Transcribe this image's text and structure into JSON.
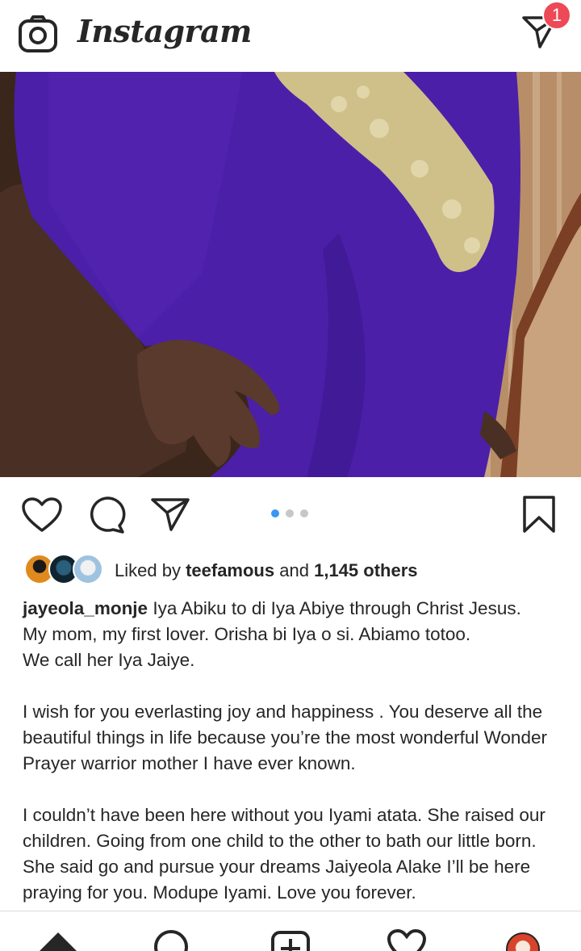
{
  "header": {
    "app_name": "Instagram",
    "camera_icon": "camera-icon",
    "direct_icon": "paper-plane-icon",
    "notification_count": "1"
  },
  "post": {
    "actions": {
      "like_icon": "heart-icon",
      "comment_icon": "comment-icon",
      "share_icon": "paper-plane-icon",
      "save_icon": "bookmark-icon"
    },
    "carousel": {
      "total": 3,
      "active_index": 0,
      "active_color": "#3897f0"
    },
    "likes": {
      "prefix": "Liked by",
      "user": "teefamous",
      "conjunction": "and",
      "others": "1,145 others"
    },
    "caption": {
      "username": "jayeola_monje",
      "first_line": "Iya Abiku to di Iya Abiye through Christ Jesus.",
      "paragraph1_rest_line1": "My mom, my first lover. Orisha bi Iya o si. Abiamo totoo.",
      "paragraph1_rest_line2": "We call her Iya Jaiye.",
      "paragraph2": "I wish for you everlasting joy and happiness . You deserve all the beautiful things in life because you’re the most wonderful Wonder Prayer warrior mother I have ever known.",
      "paragraph3": "I couldn’t have been here without you Iyami atata. She raised our children. Going from one child to the other to bath our little born.  She said go and pursue your dreams Jaiyeola Alake I’ll be here praying for you. Modupe Iyami. Love you forever."
    }
  },
  "bottom_nav": {
    "items": [
      {
        "icon": "home-icon"
      },
      {
        "icon": "search-icon"
      },
      {
        "icon": "add-post-icon"
      },
      {
        "icon": "activity-heart-icon"
      },
      {
        "icon": "profile-avatar-icon"
      }
    ]
  },
  "colors": {
    "dress_purple": "#4b1fa8",
    "embroidery_gold": "#cfc08a",
    "badge_red": "#ed4956",
    "text": "#262626"
  }
}
